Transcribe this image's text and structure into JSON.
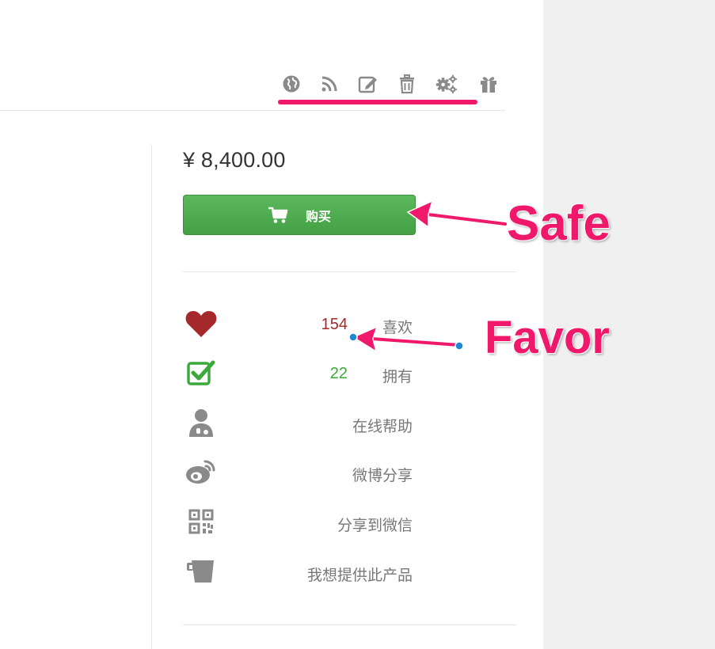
{
  "toolbar": {
    "icons": [
      "globe-icon",
      "rss-icon",
      "edit-icon",
      "trash-icon",
      "settings-icon",
      "gift-icon"
    ]
  },
  "product": {
    "price": "¥ 8,400.00",
    "buy_label": "购买"
  },
  "stats": {
    "likes": {
      "count": "154",
      "label": "喜欢"
    },
    "owned": {
      "count": "22",
      "label": "拥有"
    }
  },
  "actions": {
    "help": "在线帮助",
    "weibo": "微博分享",
    "wechat": "分享到微信",
    "provide": "我想提供此产品"
  },
  "annotations": {
    "safe": "Safe",
    "favor": "Favor"
  },
  "colors": {
    "accent_pink": "#f0186a",
    "buy_green": "#4cae4c",
    "heart_red": "#a5292b",
    "check_green": "#3aa83a",
    "icon_gray": "#888888"
  }
}
